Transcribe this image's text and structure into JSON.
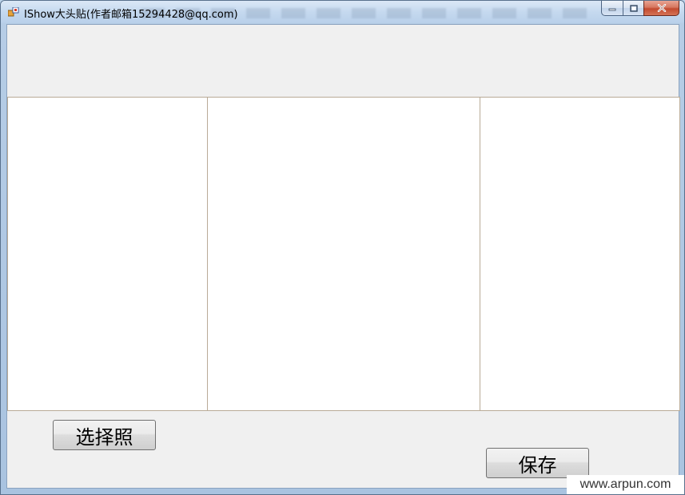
{
  "window": {
    "title": "IShow大头贴(作者邮箱15294428@qq.com)"
  },
  "caption_buttons": {
    "minimize": "minimize-icon",
    "maximize": "maximize-icon",
    "close": "close-icon"
  },
  "buttons": {
    "select_photo": "选择照",
    "save": "保存"
  },
  "watermark": "www.arpun.com",
  "colors": {
    "titlebar": "#c5d9ef",
    "client_bg": "#f0f0f0",
    "panel_bg": "#ffffff",
    "panel_border": "#b9ab97",
    "close_button": "#c24a2f"
  }
}
